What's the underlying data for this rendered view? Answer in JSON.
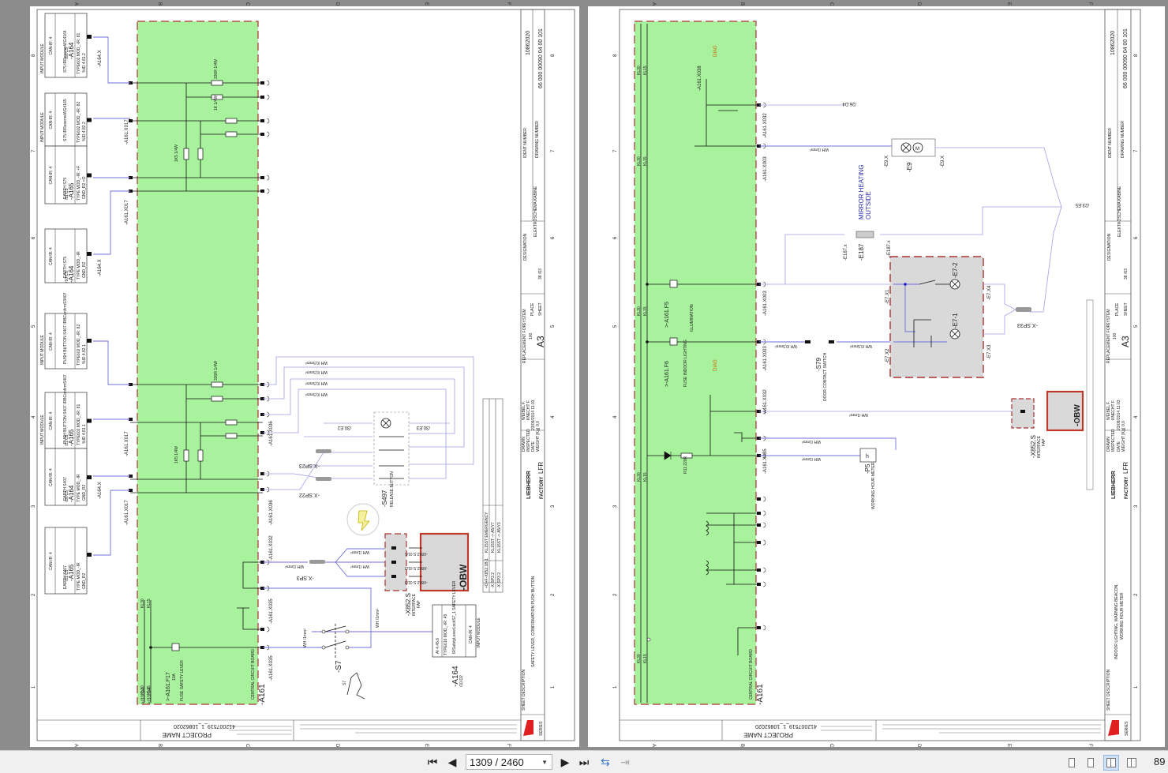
{
  "viewer": {
    "page_input": "1309 / 2460",
    "zoom": "89",
    "icons": [
      "first-page-icon",
      "prev-page-icon",
      "next-page-icon",
      "last-page-icon",
      "rotate-icon",
      "export-icon",
      "single-page-icon",
      "continuous-icon",
      "two-page-icon",
      "two-page-continuous-icon"
    ]
  },
  "columns": [
    "A",
    "B",
    "C",
    "D",
    "E",
    "F"
  ],
  "rows": [
    "8",
    "7",
    "6",
    "5",
    "4",
    "3",
    "2",
    "1"
  ],
  "colors": {
    "board": "#a8f29e",
    "wire_blue": "#6f6fd8",
    "border_red": "#c0392b",
    "module_gray": "#d9d9d9"
  },
  "left": {
    "title_block": {
      "ident_label": "IDENT NUMBER",
      "ident": "10862020",
      "drawing_label": "DRAWING NUMBER",
      "drawing": "66 000 00090 04 00 101",
      "designation_label": "DESIGNATION",
      "designation": "ELEKTROSCHEMA KABINE",
      "system_label": "SYSTEM",
      "place_label": "PLACE",
      "sheet_label": "SHEET",
      "sheet": "38 /63",
      "replacement_label": "REPLACEMENT FOR",
      "replacement": "100",
      "format": "A3",
      "drawn_label": "DRAWN",
      "drawn": "WEIBEL F.",
      "inspected_label": "INSPECTED",
      "inspected": "KNECHT F.",
      "date_label": "DATE",
      "date": "23/09/2014 11:03",
      "weight_label": "WEIGHT [Kg]",
      "weight": "0,0",
      "brand": "LIEBHERR",
      "factory_label": "FACTORY",
      "factory": "LFR",
      "sheet_desc_label": "SHEET DESCRIPTION",
      "sheet_desc": "SAFETY LEVER, CONFIRMATION PUSH BUTTON",
      "series": "SERIES"
    },
    "project_label": "PROJECT NAME",
    "project": "412007519_1_10862020",
    "board": "-A161",
    "board_desc": "CENTRAL CIRCUIT BOARD",
    "modules": [
      {
        "head": "INPUT MODULE",
        "can": "CAN-IR: 4",
        "name": "S75 IRReserveWG4164",
        "type": "TYPE602  MOD_-IR: 81",
        "id": "%ID 4.81.2",
        "ref": "-A164",
        "pos": "/10.C5"
      },
      {
        "head": "INPUT MODULE",
        "can": "CAN-IR: 4",
        "name": "S75 IRReserveWG4165",
        "type": "TYPE602  MOD_-IR: 82",
        "id": "%ID 4.82.2",
        "ref": "",
        "pos": ""
      },
      {
        "head": "",
        "can": "CAN-IR: 4",
        "name": "EARTH S75",
        "type": "TYPE  MOD_-IR: +F",
        "id": "GND_R2  =O",
        "ref": "-A165",
        "pos": "/11.C5"
      },
      {
        "head": "",
        "can": "CAN-IR: 4",
        "name": "EARTH S75",
        "type": "TYPE  MOD_-IR",
        "id": "GND_R2",
        "ref": "-A164",
        "pos": "/10.C5"
      },
      {
        "head": "INPUT MODULE",
        "can": "CAN-IR: 4",
        "name": "PUSH BUTTON S407 IRBConfirmS3407",
        "type": "TYPE602  MOD_-IR: 82",
        "id": "%ID 4.82.1",
        "ref": "",
        "pos": ""
      },
      {
        "head": "INPUT MODULE",
        "can": "CAN-IR: 4",
        "name": "PUSH BUTTON S407 IRBConfirmS407",
        "type": "TYPE602  MOD_-IR: 81",
        "id": "%ID 4.81.1",
        "ref": "-A165",
        "pos": "/11.C5"
      },
      {
        "head": "",
        "can": "CAN-IR: 4",
        "name": "EARTH S407",
        "type": "TYPE  MOD_-IR",
        "id": "GND_R2",
        "ref": "-A164",
        "pos": "/10.C5"
      },
      {
        "head": "",
        "can": "CAN-IR: 4",
        "name": "EARTH S407",
        "type": "TYPE  MOD_-IR",
        "id": "GND_R2",
        "ref": "-A165",
        "pos": "/11.C5"
      }
    ],
    "labels": {
      "x017": "-A161.X017",
      "x164": "-A164.X",
      "x036": "-A161.X036",
      "x032": "-A161.X032",
      "x035": "-A161.X035",
      "r330": "330R 1/4W",
      "r1k": "1K 1/4W",
      "r1k5": "1K5 1/4W",
      "wire": "WH /0,5mm²",
      "wire1": "WH /1mm²",
      "s497": "-S497",
      "release": "RELEASE BUTTON",
      "sp22": "-X.SP22",
      "sp23": "-X.SP23",
      "sp3": "-X.SP3",
      "e32": "/30.E2",
      "e31": "/30.E3",
      "x852": "-X852.S",
      "interface": "INTERFACE",
      "fap": "FAP",
      "obw": "-OBW",
      "obw_pins": [
        "-X852.S 01/1",
        "-X852.S 01/2",
        "-X852.S 01/3"
      ],
      "kl30": "KL30",
      "kl15": "KL15",
      "kl30_ref": ">/33.D4",
      "kl15_ref": ">/33.D4",
      "fuse": ">-A161.F17",
      "fuse_desc": "FUSE SAFETY LEVER",
      "fuse_val": "10A",
      "s7": "-S7",
      "s7_small": "S7",
      "safety_module": [
        "INPUT MODULE",
        "CAN-IR: 4",
        "IRSafetyLeverLockS7_1 SAFETY LEVER",
        "TYPE616  MOD_-IR: 45",
        "AI 4.45.6"
      ],
      "safety_ref": "-A164",
      "safety_pos": "/10.D2",
      "table": [
        "KL15ST EMERGENCY",
        "KL15ST -> A5/Y7",
        "KL15ST -> A5/Y3",
        "+O+F-X852.1B.1",
        "-X.SP3.2",
        "-X.SP3.2",
        "KL15ST",
        "KL15ST",
        "KL15ST",
        "18",
        "18",
        "17"
      ]
    }
  },
  "right": {
    "title_block": {
      "ident_label": "IDENT NUMBER",
      "ident": "10862020",
      "drawing_label": "DRAWING NUMBER",
      "drawing": "66 000 00090 04 00 101",
      "designation_label": "DESIGNATION",
      "designation": "ELEKTROSCHEMA KABINE",
      "system_label": "SYSTEM",
      "place_label": "PLACE",
      "sheet_label": "SHEET",
      "sheet": "38 /63",
      "replacement_label": "REPLACEMENT FOR",
      "replacement": "100",
      "format": "A3",
      "drawn_label": "DRAWN",
      "drawn": "WEIBEL F.",
      "inspected_label": "INSPECTED",
      "inspected": "KNECHT F.",
      "date_label": "DATE",
      "date": "23/09/2014 11:03",
      "weight_label": "WEIGHT [Kg]",
      "weight": "0,0",
      "brand": "LIEBHERR",
      "factory_label": "FACTORY",
      "factory": "LFR",
      "sheet_desc_label": "SHEET DESCRIPTION",
      "sheet_desc": "INDOOR LIGHTING, WARNING BEACON,",
      "sheet_desc2": "WORKING HOUR METER",
      "series": "SERIES"
    },
    "project_label": "PROJECT NAME",
    "project": "412007519_1_10862020",
    "board": "-A161",
    "board_desc": "CENTRAL CIRCUIT BOARD",
    "labels": {
      "mirror1": "MIRROR HEATING",
      "mirror2": "OUTSIDE",
      "e9": "-E9",
      "e9x1": "-E9.X",
      "e9x2": "-E9.X",
      "e187": "-E187",
      "e187x1": "-E187.x",
      "e187x2": "-E187.x",
      "e72": "-E7-2",
      "e71": "-E7-1",
      "e7x1": "-E7.X1",
      "e7x2": "-E7.X2",
      "e7x3": "-E7.X3",
      "e7x4": "-E7.X4",
      "sp33": "-X.SP33",
      "e5ref": "/23.E5",
      "d4ref": "/26.D4",
      "s79": "-S79",
      "door": "DOOR CONTACT SWITCH",
      "p5": "-P5",
      "p5desc": "WORKING HOUR METER",
      "x852": "-X852.S",
      "interface": "INTERFACE",
      "fap": "FAP",
      "obw": "-OBW",
      "f5": ">-A161.F5",
      "f6": ">-A161.F6",
      "f5desc": "ILLUMINATION",
      "f6desc": "FUSE INDOOR LIGHTING",
      "diag": "DIAG",
      "r11": "R11 220R",
      "x003": "-A161.X003",
      "x032": "-A161.X032",
      "x035": "-A161.X035",
      "x038": "-A161.X038",
      "kl30": "KL30",
      "kl15": "KL15",
      "wire": "WH /1mm²",
      "wire05": "WH /0,5mm²"
    }
  }
}
